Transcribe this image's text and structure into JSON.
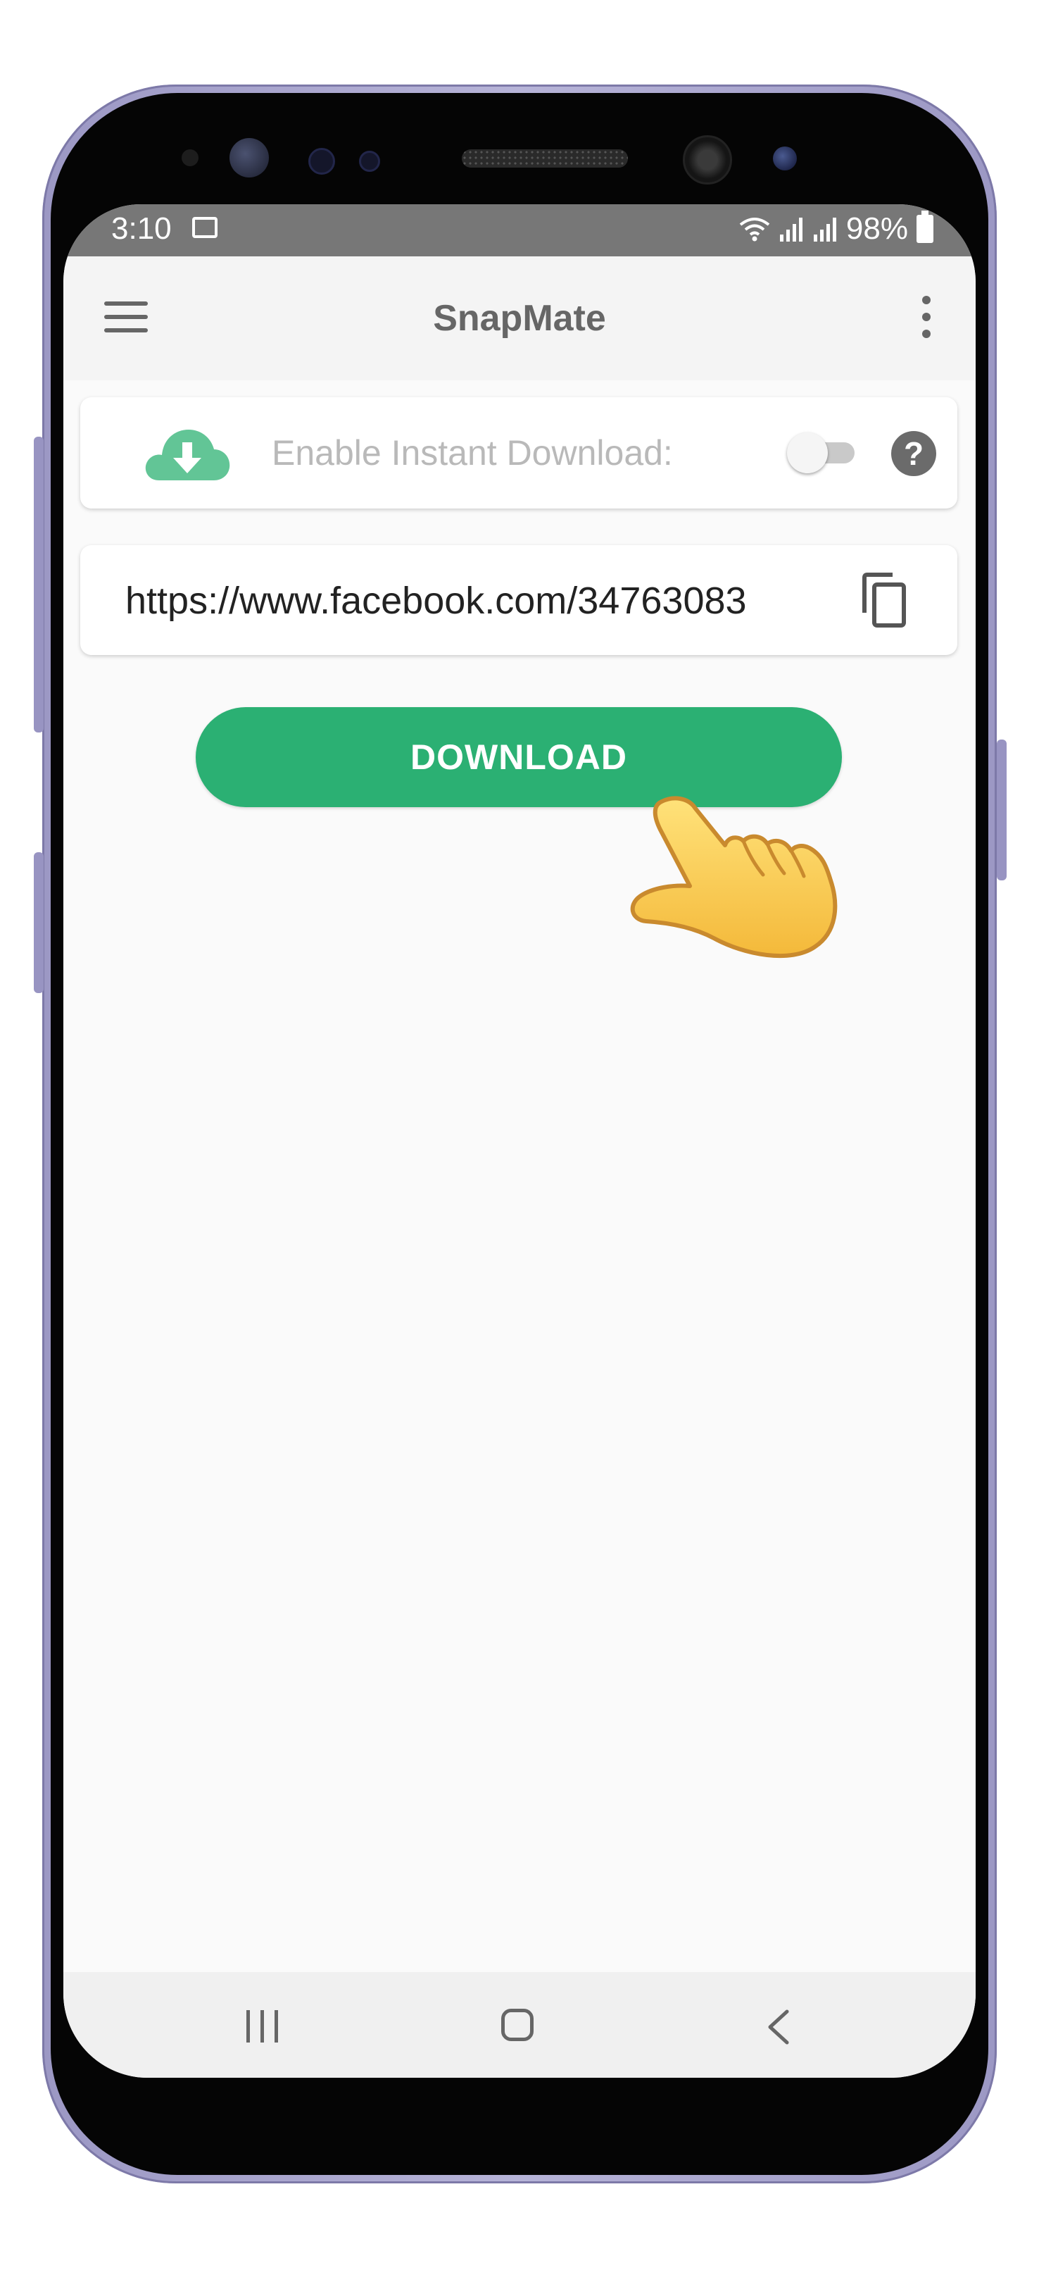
{
  "status_bar": {
    "time": "3:10",
    "battery": "98%",
    "icons": [
      "image-icon",
      "wifi-icon",
      "signal-icon",
      "signal-icon",
      "battery-icon"
    ]
  },
  "app_bar": {
    "title": "SnapMate",
    "left_icon": "menu-icon",
    "right_icon": "more-vert-icon"
  },
  "instant_download": {
    "icon": "cloud-download-icon",
    "label": "Enable Instant Download:",
    "enabled": false,
    "help_symbol": "?"
  },
  "url_input": {
    "value": "https://www.facebook.com/34763083",
    "icon": "copy-icon"
  },
  "download_button": {
    "label": "DOWNLOAD"
  },
  "navigation_bar": {
    "items": [
      "recent-apps-icon",
      "home-icon",
      "back-icon"
    ]
  },
  "colors": {
    "accent": "#2bb073",
    "cloud_icon": "#62c596",
    "status_bar": "#777777",
    "app_bar": "#f4f4f4",
    "background": "#fafafa",
    "phone_frame": "#9c98c4"
  }
}
